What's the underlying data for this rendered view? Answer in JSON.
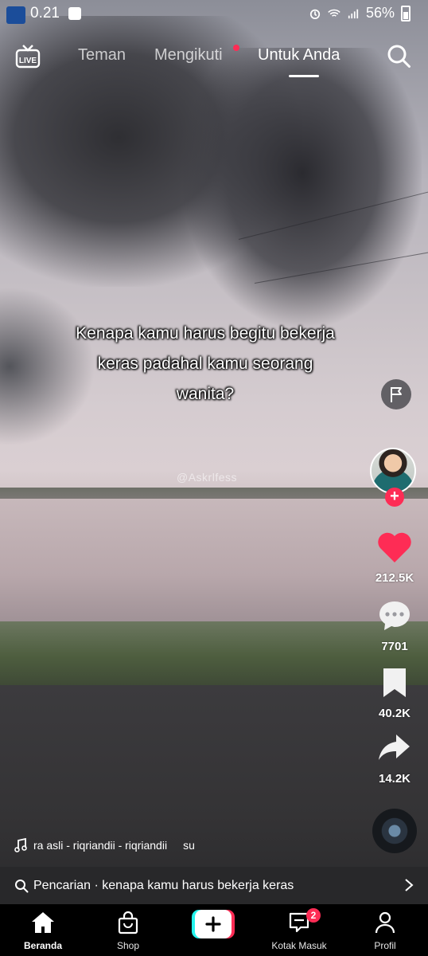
{
  "status_bar": {
    "time": "0.21",
    "battery": "56%",
    "icons": [
      "app-badge-icon",
      "shopping-bag-icon",
      "alarm-icon",
      "wifi-icon",
      "signal-icon",
      "battery-icon"
    ]
  },
  "top_nav": {
    "tabs": [
      {
        "label": "Teman",
        "active": false
      },
      {
        "label": "Mengikuti",
        "active": false,
        "has_dot": true
      },
      {
        "label": "Untuk Anda",
        "active": true
      }
    ],
    "live_icon": "live-tv-icon",
    "search_icon": "search-icon"
  },
  "video": {
    "caption": "Kenapa kamu harus begitu bekerja keras padahal kamu seorang wanita?",
    "watermark": "@Askrlfess"
  },
  "right_rail": {
    "like_count": "212.5K",
    "comment_count": "7701",
    "bookmark_count": "40.2K",
    "share_count": "14.2K"
  },
  "music": {
    "text": "ra asli - riqriandii - riqriandii",
    "trail": "su"
  },
  "search_bar": {
    "text": "Pencarian · kenapa kamu harus bekerja keras"
  },
  "bottom_nav": {
    "items": [
      {
        "label": "Beranda",
        "active": true
      },
      {
        "label": "Shop",
        "active": false
      },
      {
        "label": "",
        "active": false
      },
      {
        "label": "Kotak Masuk",
        "active": false,
        "badge": "2"
      },
      {
        "label": "Profil",
        "active": false
      }
    ]
  },
  "colors": {
    "accent_red": "#fe2c55",
    "like_heart": "#fe2c55",
    "create_cyan": "#25f4ee"
  }
}
